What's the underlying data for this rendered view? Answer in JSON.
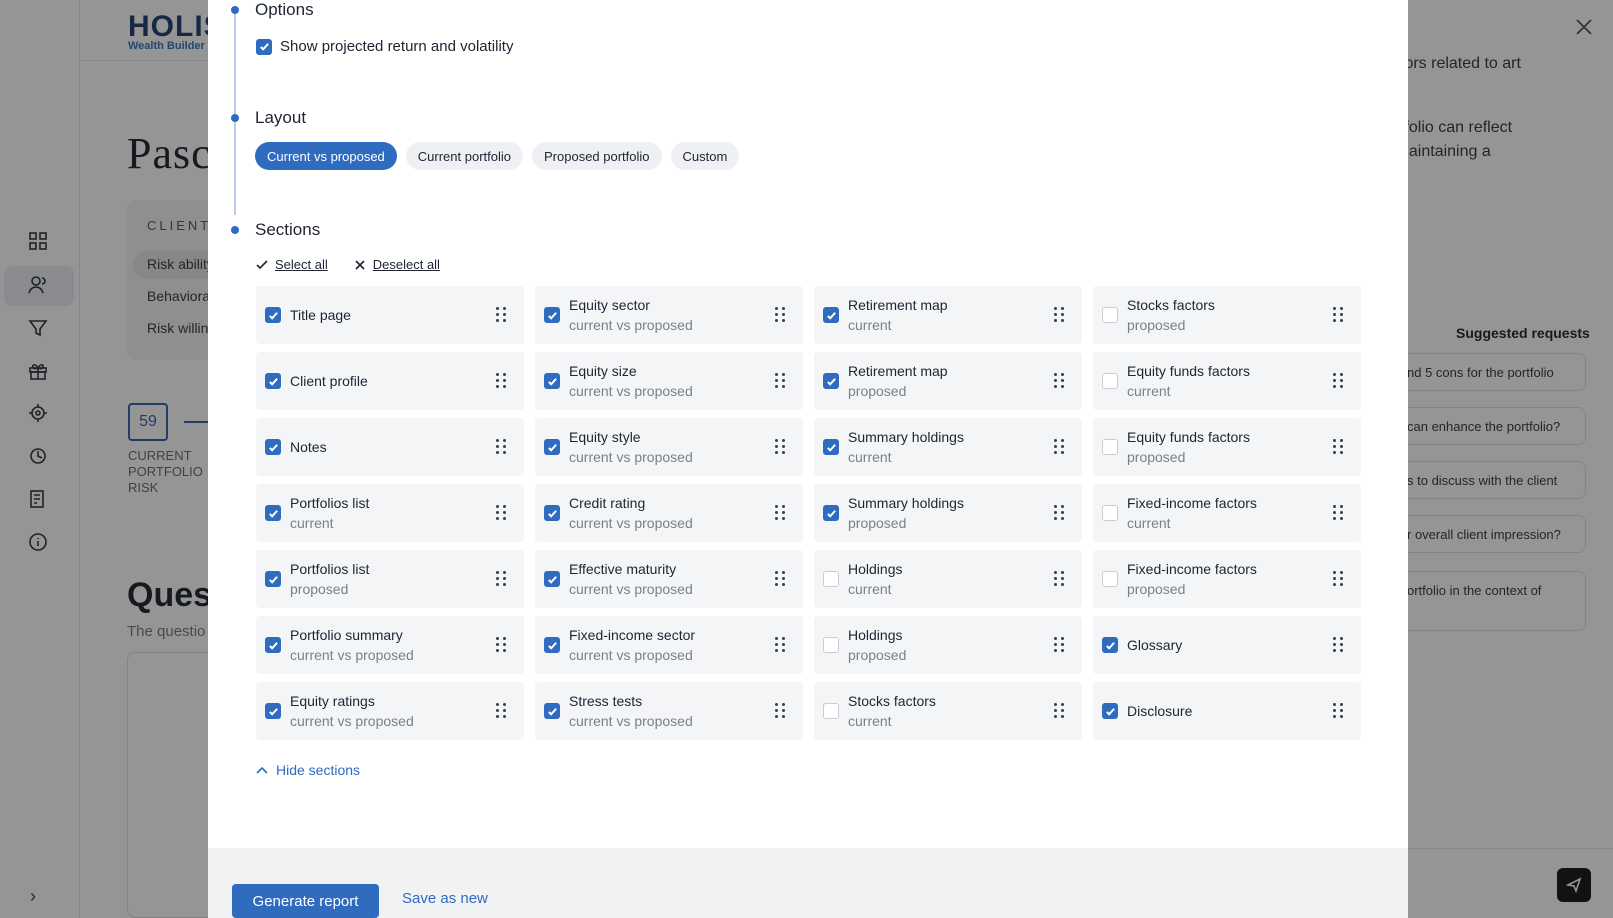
{
  "background": {
    "logo_main": "HOLIS",
    "logo_sub": "Wealth Builder",
    "page_title": "Pasc",
    "client_label": "CLIENT",
    "client_items": [
      "Risk ability",
      "Behaviora",
      "Risk willing"
    ],
    "score_value": "59",
    "score_label": "CURRENT PORTFOLIO RISK",
    "questions_title": "Ques",
    "questions_sub": "The questio",
    "right_texts": [
      "tors related to art",
      "tfolio can reflect",
      "naintaining a"
    ],
    "suggested_title": "Suggested requests",
    "suggested": [
      "nd 5 cons for the portfolio",
      "can enhance the portfolio?",
      "s to discuss with the client",
      "r overall client impression?",
      "ortfolio in the context of"
    ],
    "sidebar_icons": [
      "dashboard-icon",
      "clients-icon",
      "funnel-icon",
      "gift-icon",
      "target-icon",
      "history-icon",
      "report-icon",
      "info-icon"
    ]
  },
  "modal": {
    "options_title": "Options",
    "show_projected_label": "Show projected return and volatility",
    "show_projected_checked": true,
    "layout_title": "Layout",
    "layout_options": [
      "Current vs proposed",
      "Current portfolio",
      "Proposed portfolio",
      "Custom"
    ],
    "layout_selected": "Current vs proposed",
    "sections_title": "Sections",
    "select_all": "Select all",
    "deselect_all": "Deselect all",
    "sections": [
      {
        "name": "Title page",
        "sub": "",
        "checked": true
      },
      {
        "name": "Equity sector",
        "sub": "current vs proposed",
        "checked": true
      },
      {
        "name": "Retirement map",
        "sub": "current",
        "checked": true
      },
      {
        "name": "Stocks factors",
        "sub": "proposed",
        "checked": false
      },
      {
        "name": "Client profile",
        "sub": "",
        "checked": true
      },
      {
        "name": "Equity size",
        "sub": "current vs proposed",
        "checked": true
      },
      {
        "name": "Retirement map",
        "sub": "proposed",
        "checked": true
      },
      {
        "name": "Equity funds factors",
        "sub": "current",
        "checked": false
      },
      {
        "name": "Notes",
        "sub": "",
        "checked": true
      },
      {
        "name": "Equity style",
        "sub": "current vs proposed",
        "checked": true
      },
      {
        "name": "Summary holdings",
        "sub": "current",
        "checked": true
      },
      {
        "name": "Equity funds factors",
        "sub": "proposed",
        "checked": false
      },
      {
        "name": "Portfolios list",
        "sub": "current",
        "checked": true
      },
      {
        "name": "Credit rating",
        "sub": "current vs proposed",
        "checked": true
      },
      {
        "name": "Summary holdings",
        "sub": "proposed",
        "checked": true
      },
      {
        "name": "Fixed-income factors",
        "sub": "current",
        "checked": false
      },
      {
        "name": "Portfolios list",
        "sub": "proposed",
        "checked": true
      },
      {
        "name": "Effective maturity",
        "sub": "current vs proposed",
        "checked": true
      },
      {
        "name": "Holdings",
        "sub": "current",
        "checked": false
      },
      {
        "name": "Fixed-income factors",
        "sub": "proposed",
        "checked": false
      },
      {
        "name": "Portfolio summary",
        "sub": "current vs proposed",
        "checked": true
      },
      {
        "name": "Fixed-income sector",
        "sub": "current vs proposed",
        "checked": true
      },
      {
        "name": "Holdings",
        "sub": "proposed",
        "checked": false
      },
      {
        "name": "Glossary",
        "sub": "",
        "checked": true
      },
      {
        "name": "Equity ratings",
        "sub": "current vs proposed",
        "checked": true
      },
      {
        "name": "Stress tests",
        "sub": "current vs proposed",
        "checked": true
      },
      {
        "name": "Stocks factors",
        "sub": "current",
        "checked": false
      },
      {
        "name": "Disclosure",
        "sub": "",
        "checked": true
      }
    ],
    "hide_sections": "Hide sections",
    "generate_button": "Generate report",
    "save_as_new": "Save as new"
  },
  "colors": {
    "accent": "#2f6bbf",
    "card_bg": "#f4f5f7",
    "overlay": "rgba(20,20,20,0.45)"
  }
}
